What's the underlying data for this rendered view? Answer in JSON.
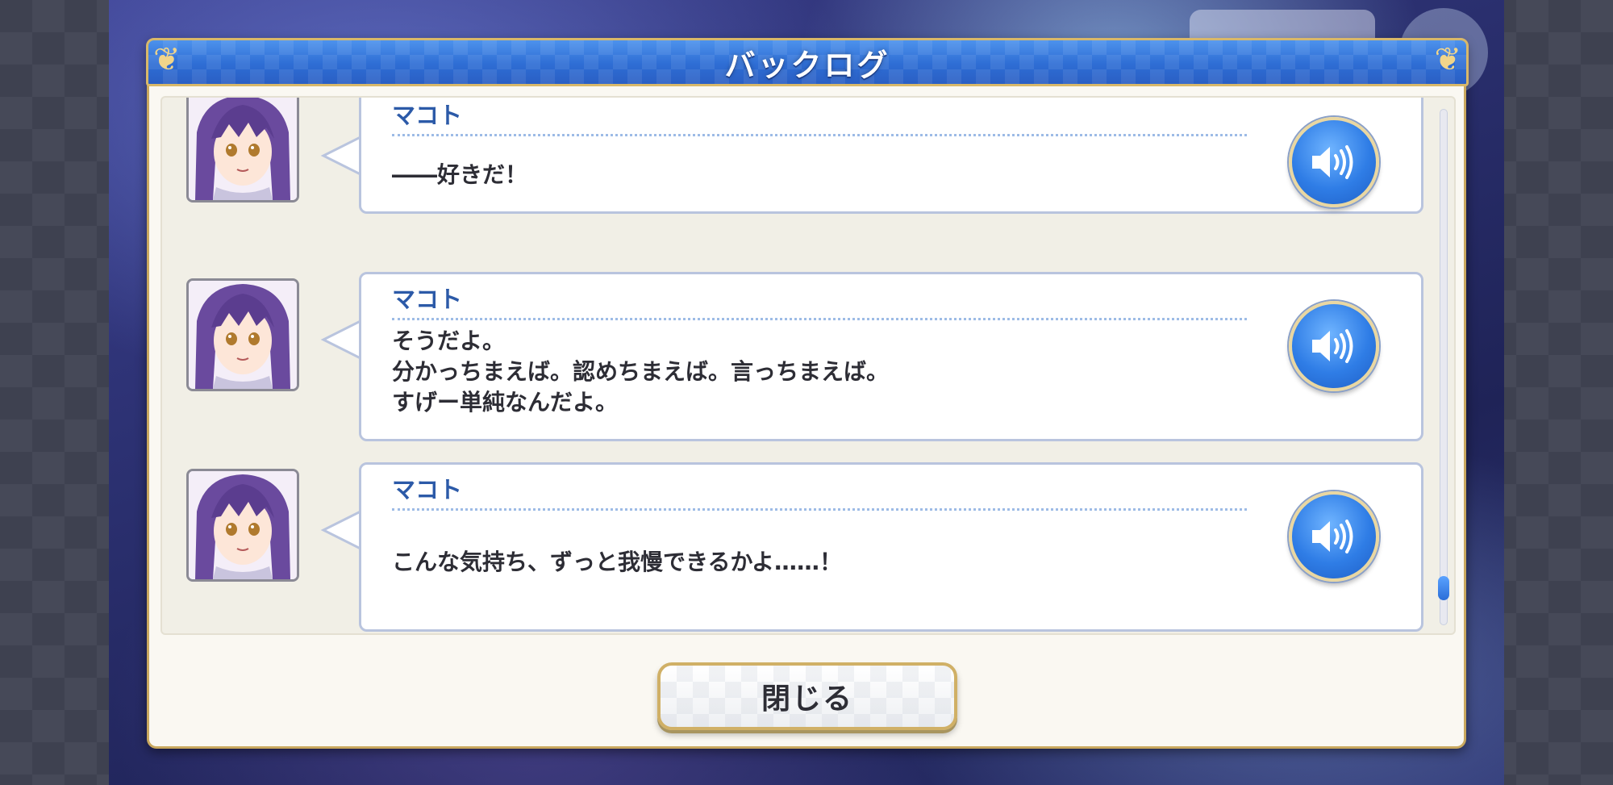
{
  "window": {
    "title": "バックログ"
  },
  "entries": [
    {
      "speaker": "マコト",
      "lines": [
        "――好きだ！"
      ]
    },
    {
      "speaker": "マコト",
      "lines": [
        "そうだよ。",
        "分かっちまえば。認めちまえば。言っちまえば。",
        "すげー単純なんだよ。"
      ]
    },
    {
      "speaker": "マコト",
      "lines": [
        "こんな気持ち、ずっと我慢できるかよ……！"
      ]
    }
  ],
  "icons": {
    "voice": "speaker-icon",
    "portrait": "character-portrait"
  },
  "close_button": {
    "label": "閉じる"
  },
  "scrollbar": {
    "position": 0.95
  },
  "colors": {
    "title_bar": "#2e6dd4",
    "speaker_name": "#2c5aa8",
    "frame_gold": "#c9a85e",
    "voice_button": "#2f7de6"
  }
}
